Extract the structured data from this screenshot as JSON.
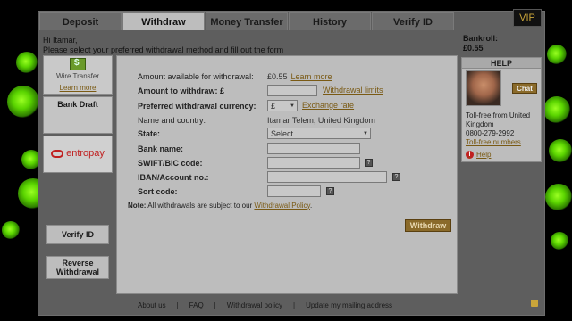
{
  "tabs": [
    {
      "label": "Deposit",
      "active": false
    },
    {
      "label": "Withdraw",
      "active": true
    },
    {
      "label": "Money Transfer",
      "active": false
    },
    {
      "label": "History",
      "active": false
    },
    {
      "label": "Verify ID",
      "active": false
    }
  ],
  "vip_label": "VIP",
  "greeting": {
    "line1": "Hi Itamar,",
    "line2": "Please select your preferred withdrawal method and fill out the form"
  },
  "bankroll": {
    "label": "Bankroll:",
    "value": "£0.55"
  },
  "methods": {
    "wire_label": "Wire Transfer",
    "wire_learn_more": "Learn more",
    "bank_draft": "Bank Draft",
    "entropay": "entropay"
  },
  "side_buttons": {
    "verify_id": "Verify ID",
    "reverse_withdrawal": "Reverse Withdrawal"
  },
  "form": {
    "available_label": "Amount available for withdrawal:",
    "available_value": "£0.55",
    "available_link": "Learn more",
    "amount_label": "Amount to withdraw: £",
    "withdrawal_limits_link": "Withdrawal limits",
    "currency_label": "Preferred withdrawal currency:",
    "currency_value": "£",
    "exchange_rate_link": "Exchange rate",
    "name_label": "Name and country:",
    "name_value": "Itamar Telem, United Kingdom",
    "state_label": "State:",
    "state_value": "Select",
    "bank_label": "Bank name:",
    "swift_label": "SWIFT/BIC code:",
    "iban_label": "IBAN/Account no.:",
    "sort_label": "Sort code:",
    "note_prefix": "Note:",
    "note_text": "All withdrawals are subject to our",
    "note_link": "Withdrawal Policy",
    "note_suffix": ".",
    "submit_label": "Withdraw"
  },
  "help": {
    "title": "HELP",
    "chat_label": "Chat",
    "tollfree_text": "Toll-free from United Kingdom",
    "phone": "0800-279-2992",
    "tollfree_link": "Toll-free numbers",
    "help_link": "Help"
  },
  "footer": [
    "About us",
    "FAQ",
    "Withdrawal policy",
    "Update my mailing address"
  ],
  "colors": {
    "accent_gold": "#8a6a2a",
    "bubble_green": "#7cff10",
    "panel_gray": "#5e5e5e"
  }
}
